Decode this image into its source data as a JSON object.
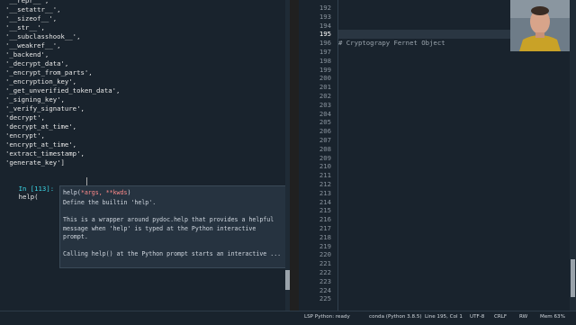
{
  "console": {
    "output_lines": [
      "'__repr__',",
      "'__setattr__',",
      "'__sizeof__',",
      "'__str__',",
      "'__subclasshook__',",
      "'__weakref__',",
      "'_backend',",
      "'_decrypt_data',",
      "'_encrypt_from_parts',",
      "'_encryption_key',",
      "'_get_unverified_token_data',",
      "'_signing_key',",
      "'_verify_signature',",
      "'decrypt',",
      "'decrypt_at_time',",
      "'encrypt',",
      "'encrypt_at_time',",
      "'extract_timestamp',",
      "'generate_key']"
    ],
    "prompt_label": "In [113]:",
    "prompt_code": "help(",
    "calltip": {
      "sig_name": "help(",
      "sig_args": "*args, **kwds",
      "sig_end": ")",
      "lines": [
        "Define the builtin 'help'.",
        "",
        "This is a wrapper around pydoc.help that provides a helpful",
        "message when 'help' is typed at the Python interactive",
        "prompt.",
        "",
        "Calling help() at the Python prompt starts an interactive ..."
      ]
    }
  },
  "editor": {
    "line_numbers": [
      "192",
      "193",
      "194",
      "195",
      "196",
      "197",
      "198",
      "199",
      "200",
      "201",
      "202",
      "203",
      "204",
      "205",
      "206",
      "207",
      "208",
      "209",
      "210",
      "211",
      "212",
      "213",
      "214",
      "215",
      "216",
      "217",
      "218",
      "219",
      "220",
      "221",
      "222",
      "223",
      "224",
      "225"
    ],
    "current_line": "195",
    "code": {
      "195": "# Cryptograpy Fernet Object"
    }
  },
  "statusbar": {
    "lsp": "LSP Python: ready",
    "env": "conda (Python 3.8.5)",
    "position": "Line 195, Col 1",
    "encoding": "UTF-8",
    "eol": "CRLF",
    "rw": "RW",
    "mem": "Mem 63%"
  },
  "colors": {
    "background": "#19232d",
    "prompt": "#3bd5e5",
    "calltip_args": "#ff8a8a"
  }
}
